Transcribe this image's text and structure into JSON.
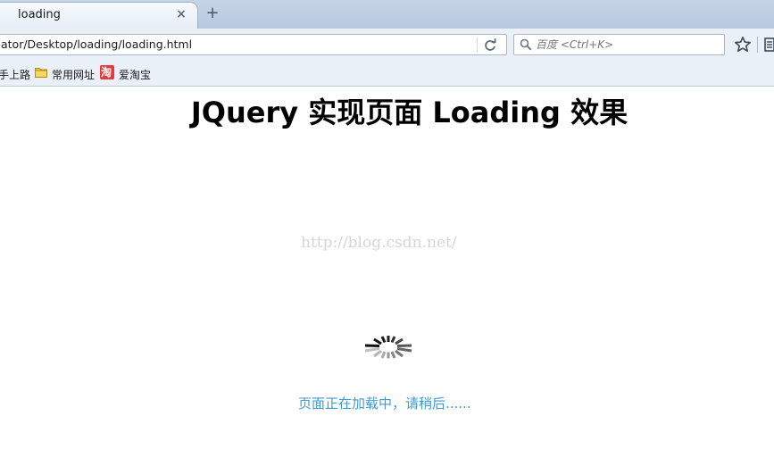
{
  "tab": {
    "title": "loading",
    "close_glyph": "×",
    "new_tab_glyph": "+"
  },
  "address": {
    "url": "ator/Desktop/loading/loading.html"
  },
  "search": {
    "placeholder": "百度 <Ctrl+K>"
  },
  "bookmarks": [
    {
      "label": "手上路",
      "icon": "none"
    },
    {
      "label": "常用网址",
      "icon": "folder-icon"
    },
    {
      "label": "爱淘宝",
      "icon": "taobao-icon"
    }
  ],
  "page": {
    "title": "JQuery 实现页面 Loading 效果",
    "watermark": "http://blog.csdn.net/",
    "loading_text": "页面正在加载中，请稍后......"
  },
  "colors": {
    "loading_text": "#3f9ad6",
    "taobao_icon": "#e23a3a",
    "folder_icon": "#f4c542"
  },
  "icons": {
    "taobao_glyph": "淘"
  }
}
